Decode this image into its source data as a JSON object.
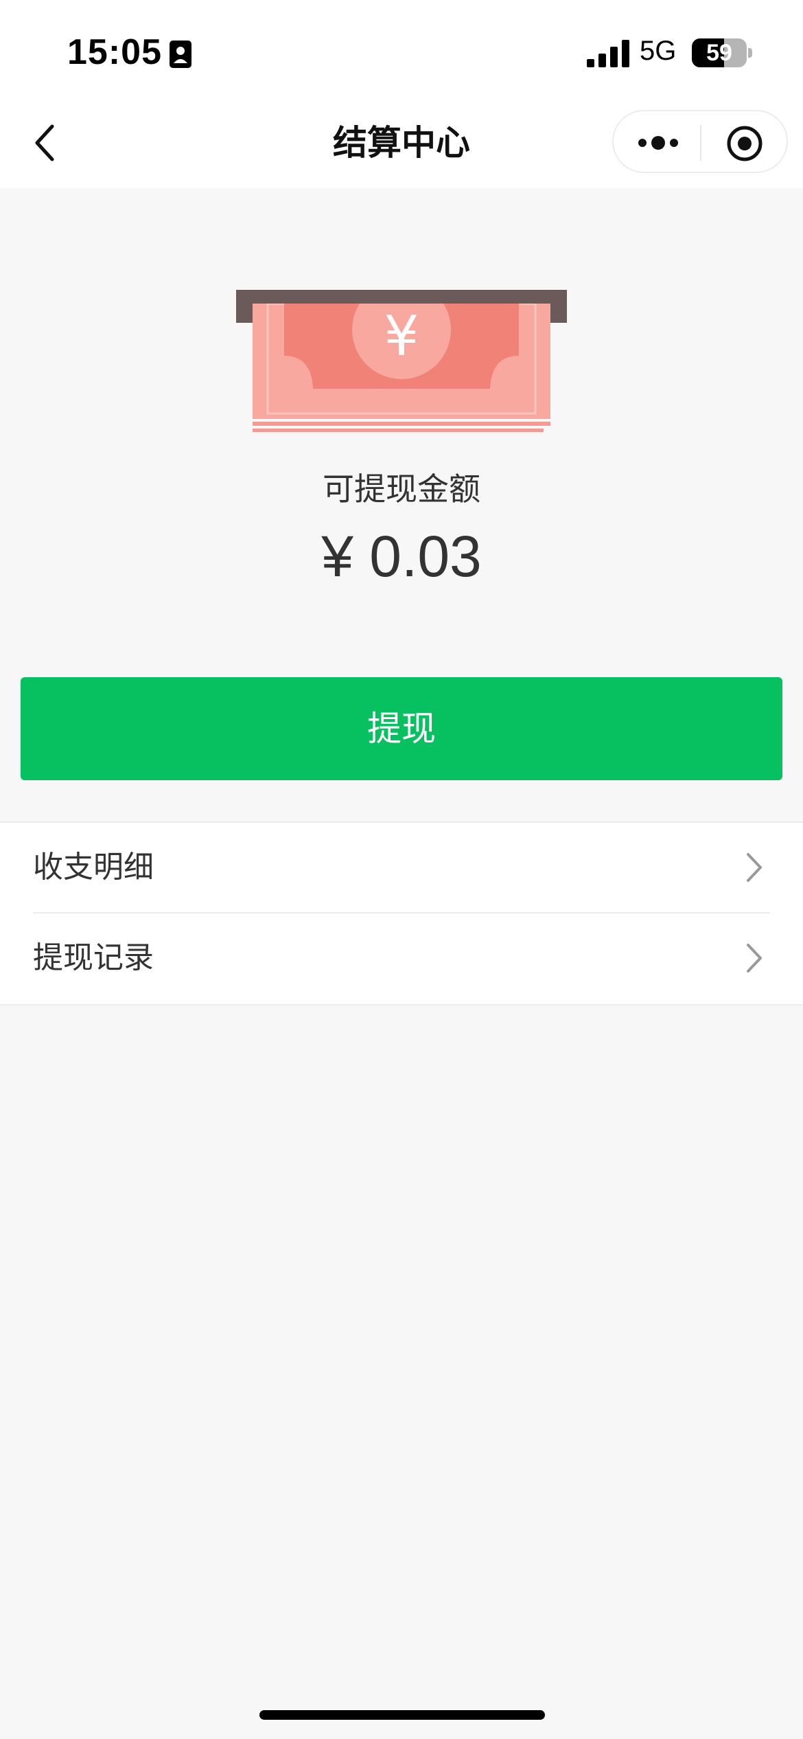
{
  "status_bar": {
    "time": "15:05",
    "network": "5G",
    "battery": "59",
    "battery_level": 0.59,
    "icons": [
      "id-card-icon",
      "signal-icon",
      "battery-icon"
    ]
  },
  "nav": {
    "title": "结算中心",
    "icons": [
      "back-icon",
      "more-icon",
      "close-miniprogram-icon"
    ]
  },
  "balance": {
    "label": "可提现金额",
    "amount": "¥ 0.03"
  },
  "withdraw_button": {
    "label": "提现",
    "color": "#07c160"
  },
  "menu": {
    "items": [
      {
        "label": "收支明细",
        "icon": "chevron-right-icon"
      },
      {
        "label": "提现记录",
        "icon": "chevron-right-icon"
      }
    ]
  },
  "illustration": {
    "symbol": "¥",
    "colors": {
      "slot": "#6b5a5a",
      "bill_outer": "#f9a8a0",
      "bill_inner": "#f08278",
      "coin": "#f9a8a0"
    }
  }
}
